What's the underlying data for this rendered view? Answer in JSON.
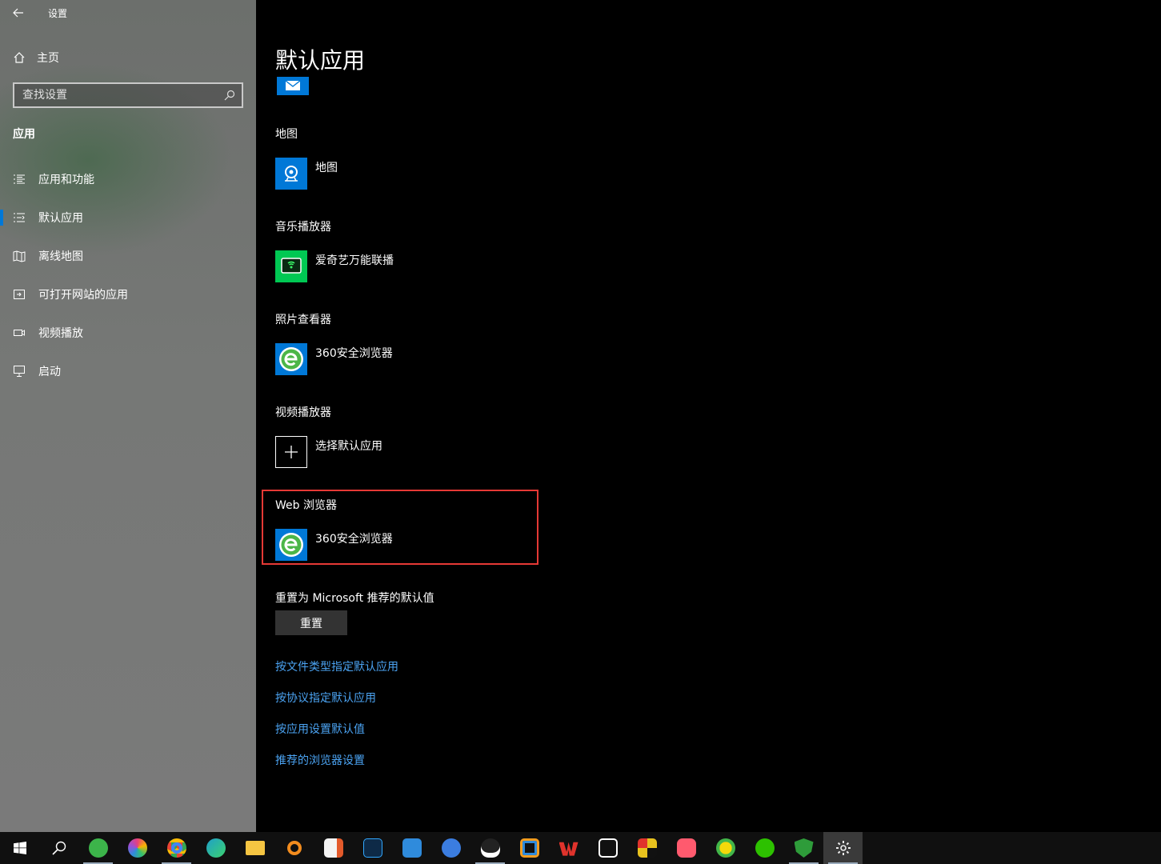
{
  "window": {
    "title": "设置"
  },
  "sidebar": {
    "home_label": "主页",
    "search_placeholder": "查找设置",
    "section": "应用",
    "items": [
      {
        "label": "应用和功能",
        "icon": "list-icon"
      },
      {
        "label": "默认应用",
        "icon": "default-apps-icon",
        "active": true
      },
      {
        "label": "离线地图",
        "icon": "map-icon"
      },
      {
        "label": "可打开网站的应用",
        "icon": "open-in-icon"
      },
      {
        "label": "视频播放",
        "icon": "video-icon"
      },
      {
        "label": "启动",
        "icon": "startup-icon"
      }
    ]
  },
  "main": {
    "title": "默认应用",
    "groups": [
      {
        "label": "地图",
        "app": "地图",
        "icon": "maps-app-icon"
      },
      {
        "label": "音乐播放器",
        "app": "爱奇艺万能联播",
        "icon": "iqiyi-cast-icon"
      },
      {
        "label": "照片查看器",
        "app": "360安全浏览器",
        "icon": "360-browser-icon"
      },
      {
        "label": "视频播放器",
        "app": "选择默认应用",
        "icon": "plus-icon"
      },
      {
        "label": "Web 浏览器",
        "app": "360安全浏览器",
        "icon": "360-browser-icon"
      }
    ],
    "reset_label": "重置为 Microsoft 推荐的默认值",
    "reset_button": "重置",
    "links": [
      "按文件类型指定默认应用",
      "按协议指定默认应用",
      "按应用设置默认值",
      "推荐的浏览器设置"
    ]
  },
  "colors": {
    "accent": "#0078d7",
    "link": "#4ba3f2",
    "highlight": "#e53935"
  },
  "taskbar": {
    "items": [
      {
        "icon": "windows-start-icon"
      },
      {
        "icon": "search-icon"
      },
      {
        "icon": "360-browser-icon",
        "color": "#3cb44a"
      },
      {
        "icon": "color-browser-icon",
        "color": "#e9407a"
      },
      {
        "icon": "chrome-icon",
        "color": "#4285f4"
      },
      {
        "icon": "edge-icon",
        "color": "#1fa0c9"
      },
      {
        "icon": "file-explorer-icon",
        "color": "#f5c542"
      },
      {
        "icon": "search-tool-icon",
        "color": "#f28c1e"
      },
      {
        "icon": "office-icon",
        "color": "#e35a2b"
      },
      {
        "icon": "photoshop-icon",
        "color": "#0e2a47"
      },
      {
        "icon": "flowchart-icon",
        "color": "#2f8bdc"
      },
      {
        "icon": "ifly-icon",
        "color": "#3b7de0"
      },
      {
        "icon": "qq-icon",
        "color": "#222222"
      },
      {
        "icon": "window-tool-icon",
        "color": "#f29c1f"
      },
      {
        "icon": "wps-icon",
        "color": "#e0332c"
      },
      {
        "icon": "capcut-icon",
        "color": "#111111"
      },
      {
        "icon": "mosaic-icon",
        "color": "#e8c21e"
      },
      {
        "icon": "media-player-icon",
        "color": "#ff5a6e"
      },
      {
        "icon": "music-icon",
        "color": "#42b649"
      },
      {
        "icon": "wechat-icon",
        "color": "#2dc100"
      },
      {
        "icon": "security-icon",
        "color": "#2e9c3a"
      },
      {
        "icon": "settings-gear-icon",
        "color": "#cccccc"
      }
    ]
  }
}
